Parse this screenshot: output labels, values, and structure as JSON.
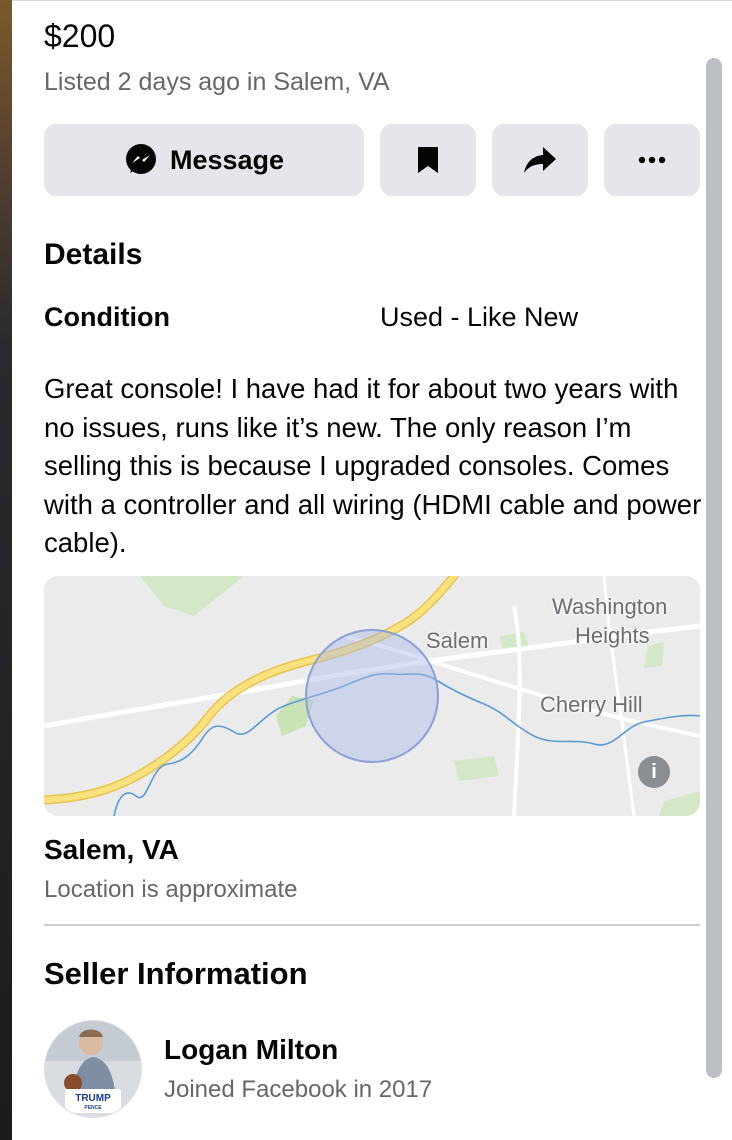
{
  "listing": {
    "price": "$200",
    "listed_text": "Listed 2 days ago in Salem, VA"
  },
  "actions": {
    "message_label": "Message",
    "save_icon": "bookmark-icon",
    "share_icon": "share-icon",
    "more_icon": "more-icon"
  },
  "details": {
    "heading": "Details",
    "condition_label": "Condition",
    "condition_value": "Used - Like New",
    "description": "Great console! I have had it for about two years with no issues, runs like it’s new. The only reason I’m selling this is because I upgraded consoles. Comes with a controller and all wiring (HDMI cable and power cable)."
  },
  "map": {
    "labels": {
      "salem": "Salem",
      "washington_line1": "Washington",
      "washington_line2": "Heights",
      "cherry_hill": "Cherry Hill"
    },
    "info_icon": "info-icon"
  },
  "location": {
    "title": "Salem, VA",
    "note": "Location is approximate"
  },
  "seller": {
    "heading": "Seller Information",
    "name": "Logan Milton",
    "joined": "Joined Facebook in 2017",
    "avatar_sign_text": "TRUMP",
    "avatar_sign_subtext": "PENCE"
  },
  "colors": {
    "button_bg": "#e4e6eb",
    "secondary_text": "#65676b",
    "map_road": "#f7dd7a",
    "map_river": "#5b9bd5",
    "map_circle": "#8aa0d8"
  }
}
